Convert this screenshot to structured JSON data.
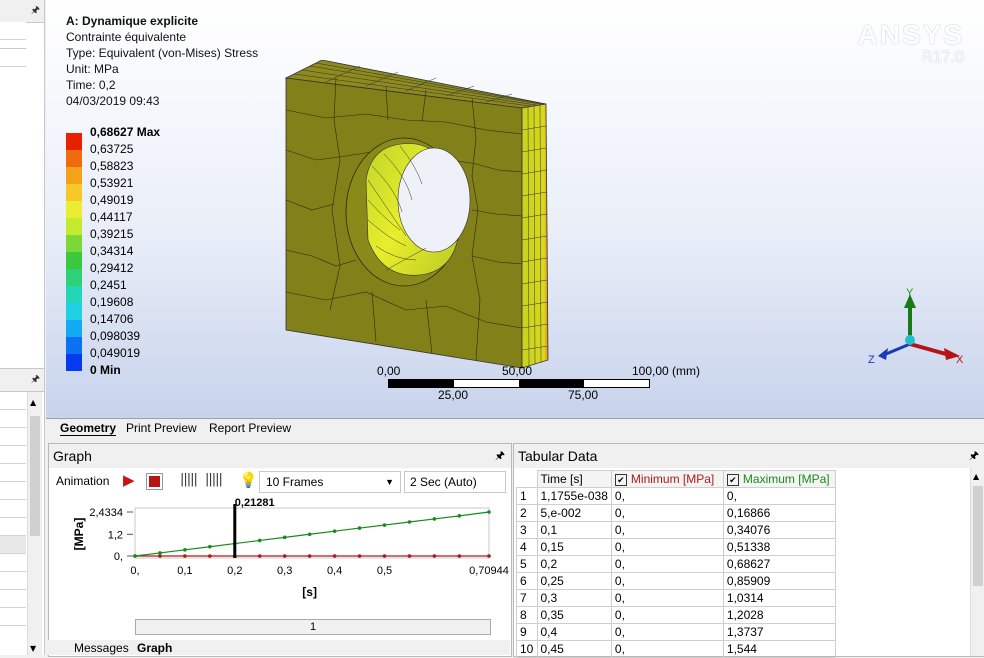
{
  "viewport": {
    "analysis_title": "A: Dynamique explicite",
    "result_name": "Contrainte équivalente",
    "type_line": "Type: Equivalent (von-Mises) Stress",
    "unit_line": "Unit: MPa",
    "time_line": "Time: 0,2",
    "date_line": "04/03/2019 09:43",
    "brand_name": "ANSYS",
    "brand_version": "R17.0",
    "legend": [
      {
        "label": "0,68627 Max",
        "color": "#e82000"
      },
      {
        "label": "0,63725",
        "color": "#f06a10"
      },
      {
        "label": "0,58823",
        "color": "#f4a21a"
      },
      {
        "label": "0,53921",
        "color": "#f6c829"
      },
      {
        "label": "0,49019",
        "color": "#ecec30"
      },
      {
        "label": "0,44117",
        "color": "#c4ea30"
      },
      {
        "label": "0,39215",
        "color": "#7cd836"
      },
      {
        "label": "0,34314",
        "color": "#3cc83c"
      },
      {
        "label": "0,29412",
        "color": "#2ed07a"
      },
      {
        "label": "0,2451",
        "color": "#22d6b6"
      },
      {
        "label": "0,19608",
        "color": "#1ed2e4"
      },
      {
        "label": "0,14706",
        "color": "#12aaf2"
      },
      {
        "label": "0,098039",
        "color": "#0a72f0"
      },
      {
        "label": "0,049019",
        "color": "#063af0"
      },
      {
        "label": "0 Min",
        "color": "#0000e8"
      }
    ],
    "scale": {
      "top_labels": [
        "0,00",
        "50,00",
        "100,00 (mm)"
      ],
      "bottom_labels": [
        "25,00",
        "75,00"
      ]
    },
    "axis_triad": {
      "y": "Y",
      "x": "X",
      "z": "Z"
    }
  },
  "view_tabs": [
    "Geometry",
    "Print Preview",
    "Report Preview"
  ],
  "graph": {
    "title": "Graph",
    "animation_label": "Animation",
    "frames_value": "10 Frames",
    "duration_value": "2 Sec (Auto)",
    "cursor_value": "0,21281",
    "slider_value": "1",
    "bottom_tabs": [
      "Messages",
      "Graph"
    ]
  },
  "chart_data": {
    "type": "line",
    "xlabel": "[s]",
    "ylabel": "[MPa]",
    "x_ticks": [
      "0,",
      "0,1",
      "0,2",
      "0,3",
      "0,4",
      "0,5",
      "0,70944"
    ],
    "y_ticks": [
      "0,",
      "1,2",
      "2,4334"
    ],
    "xlim": [
      0,
      0.70944
    ],
    "ylim": [
      0,
      2.4334
    ],
    "cursor_x": 0.2,
    "series": [
      {
        "name": "Maximum [MPa]",
        "color": "#1a8a1a",
        "x": [
          0,
          0.05,
          0.1,
          0.15,
          0.2,
          0.25,
          0.3,
          0.35,
          0.4,
          0.45,
          0.5,
          0.55,
          0.6,
          0.65,
          0.70944
        ],
        "y": [
          0,
          0.16866,
          0.34076,
          0.51338,
          0.68627,
          0.85909,
          1.0314,
          1.2028,
          1.3737,
          1.544,
          1.71,
          1.88,
          2.05,
          2.22,
          2.4334
        ]
      },
      {
        "name": "Minimum [MPa]",
        "color": "#b01818",
        "x": [
          0,
          0.05,
          0.1,
          0.15,
          0.2,
          0.25,
          0.3,
          0.35,
          0.4,
          0.45,
          0.5,
          0.55,
          0.6,
          0.65,
          0.70944
        ],
        "y": [
          0,
          0,
          0,
          0,
          0,
          0,
          0,
          0,
          0,
          0,
          0,
          0,
          0,
          0,
          0
        ]
      }
    ]
  },
  "tabular": {
    "title": "Tabular Data",
    "columns": [
      "Time [s]",
      "Minimum [MPa]",
      "Maximum [MPa]"
    ],
    "rows": [
      [
        "1",
        "1,1755e-038",
        "0,",
        "0,"
      ],
      [
        "2",
        "5,e-002",
        "0,",
        "0,16866"
      ],
      [
        "3",
        "0,1",
        "0,",
        "0,34076"
      ],
      [
        "4",
        "0,15",
        "0,",
        "0,51338"
      ],
      [
        "5",
        "0,2",
        "0,",
        "0,68627"
      ],
      [
        "6",
        "0,25",
        "0,",
        "0,85909"
      ],
      [
        "7",
        "0,3",
        "0,",
        "1,0314"
      ],
      [
        "8",
        "0,35",
        "0,",
        "1,2028"
      ],
      [
        "9",
        "0,4",
        "0,",
        "1,3737"
      ],
      [
        "10",
        "0,45",
        "0,",
        "1,544"
      ]
    ]
  }
}
